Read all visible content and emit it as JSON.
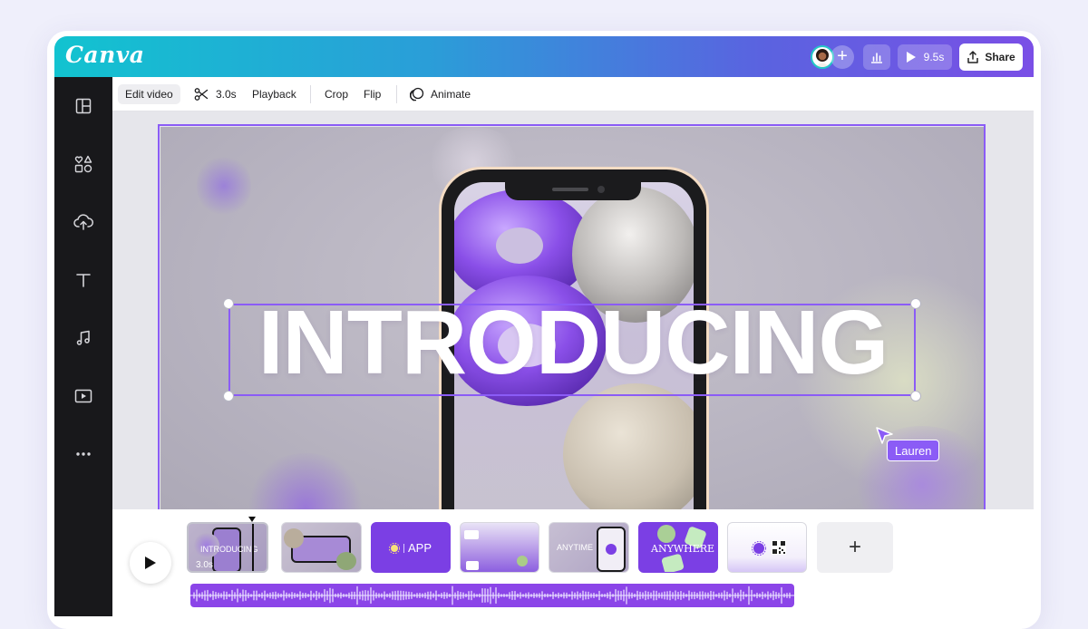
{
  "app": {
    "logo": "Canva",
    "share_label": "Share",
    "duration_label": "9.5s"
  },
  "toolbar": {
    "edit_video": "Edit video",
    "trim_duration": "3.0s",
    "playback": "Playback",
    "crop": "Crop",
    "flip": "Flip",
    "animate": "Animate"
  },
  "canvas": {
    "headline": "INTRODUCING",
    "collaborator": "Lauren"
  },
  "timeline": {
    "clips": [
      {
        "label": "INTRODUCING",
        "duration": "3.0s"
      },
      {
        "label": ""
      },
      {
        "label": "APP"
      },
      {
        "label": ""
      },
      {
        "label": "ANYTIME"
      },
      {
        "label": "ANYWHERE"
      },
      {
        "label": ""
      }
    ],
    "add_label": "+"
  },
  "colors": {
    "accent": "#8b5cf6",
    "rail": "#18181b",
    "audio": "#8b45e8"
  }
}
